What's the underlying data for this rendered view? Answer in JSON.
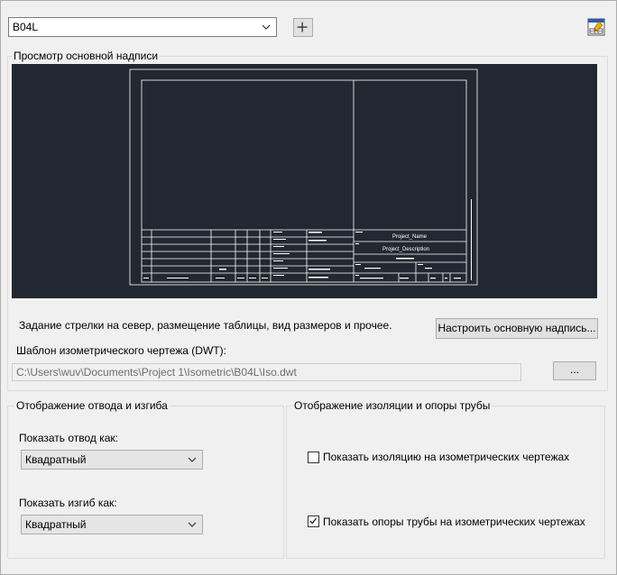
{
  "top": {
    "style_value": "B04L",
    "add_label": "+"
  },
  "preview_group": {
    "title": "Просмотр основной надписи",
    "tb_name": "Project_Name",
    "tb_desc": "Project_Description",
    "description": "Задание стрелки на север, размещение таблицы, вид размеров и прочее.",
    "configure_button": "Настроить основную надпись...",
    "template_label": "Шаблон изометрического чертежа (DWT):",
    "template_path": "C:\\Users\\wuv\\Documents\\Project 1\\Isometric\\B04L\\Iso.dwt",
    "browse_button": "..."
  },
  "elbow_group": {
    "title": "Отображение отвода и изгиба",
    "elbow_label": "Показать отвод как:",
    "elbow_value": "Квадратный",
    "bend_label": "Показать изгиб как:",
    "bend_value": "Квадратный"
  },
  "insulation_group": {
    "title": "Отображение изоляции и опоры трубы",
    "show_insulation": "Показать изоляцию на изометрических чертежах",
    "show_insulation_checked": false,
    "show_supports": "Показать опоры трубы на изометрических чертежах",
    "show_supports_checked": true
  },
  "icons": {
    "dropdown": "chevron-down-icon",
    "add": "plus-icon",
    "settings": "edit-settings-icon",
    "check": "checkmark-icon"
  }
}
